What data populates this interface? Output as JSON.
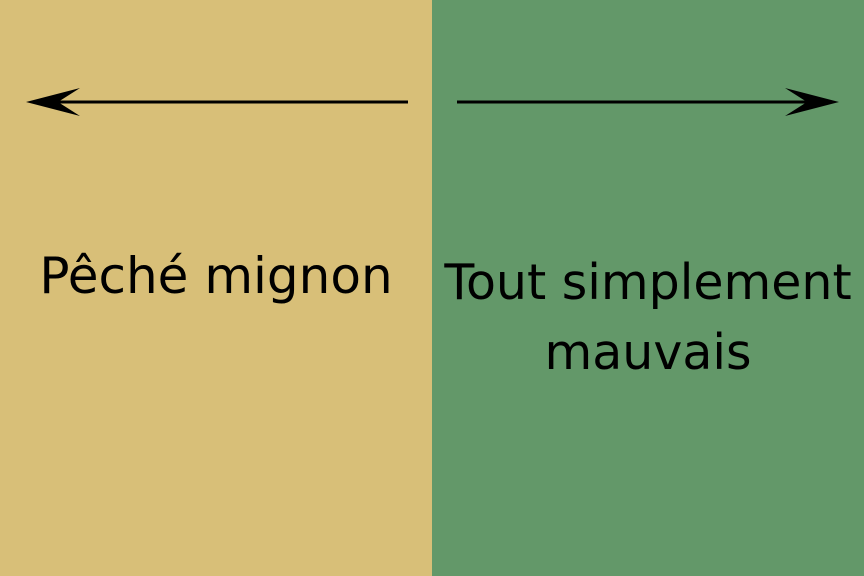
{
  "panels": {
    "left": {
      "label": "Pêché mignon",
      "background": "#D8BF78",
      "arrow_direction": "left"
    },
    "right": {
      "label_line1": "Tout simplement",
      "label_line2": "mauvais",
      "background": "#639869",
      "arrow_direction": "right"
    }
  },
  "arrow_color": "#000000"
}
